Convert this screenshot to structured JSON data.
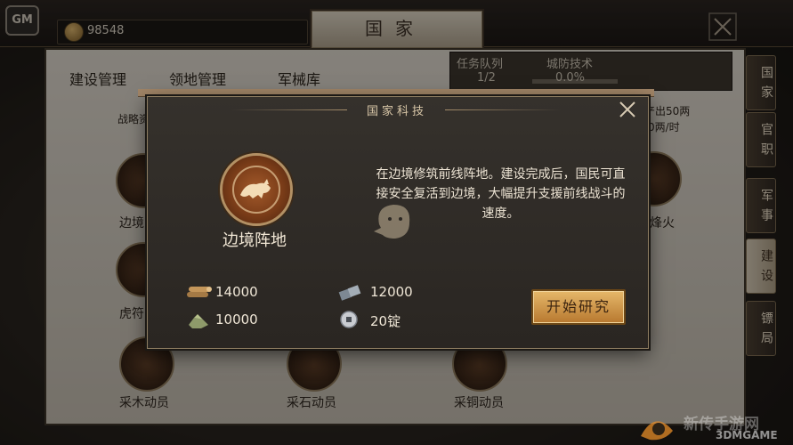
{
  "top_bar": {
    "gm_label": "GM",
    "coin_value": "98548",
    "title": "国家"
  },
  "tabs": [
    {
      "label": "建设管理"
    },
    {
      "label": "领地管理"
    },
    {
      "label": "军械库"
    }
  ],
  "info": {
    "task_queue_label": "任务队列",
    "task_queue_value": "1/2",
    "city_tech_label": "城防技术",
    "city_tech_value": "0.0%"
  },
  "background": {
    "partial_left_label": "战略资",
    "partial_right_top": "产出50两",
    "partial_right_sub": "0两/时",
    "nodes": [
      {
        "label": "边境"
      },
      {
        "label": "虎符"
      },
      {
        "label": "烽火"
      },
      {
        "label": "采木动员"
      },
      {
        "label": "采石动员"
      },
      {
        "label": "采铜动员"
      }
    ]
  },
  "side_tabs": [
    {
      "label": "国家"
    },
    {
      "label": "官职"
    },
    {
      "label": "军事"
    },
    {
      "label": "建设"
    },
    {
      "label": "镖局"
    }
  ],
  "dialog": {
    "title": "国家科技",
    "tech_name": "边境阵地",
    "description": "在边境修筑前线阵地。建设完成后，国民可直接安全复活到边境，大幅提升支援前线战斗的速度。",
    "resources": [
      {
        "icon": "wood-icon",
        "value": "14000"
      },
      {
        "icon": "iron-icon",
        "value": "12000"
      },
      {
        "icon": "stone-icon",
        "value": "10000"
      },
      {
        "icon": "silver-icon",
        "value": "20锭"
      }
    ],
    "start_button": "开始研究"
  },
  "watermark": {
    "text_top": "新传手游网",
    "text_bottom": "3DMGAME"
  },
  "colors": {
    "accent_gold": "#c8904a",
    "dialog_bg": "#2f2b27",
    "panel_bg": "#cdc6ba"
  }
}
